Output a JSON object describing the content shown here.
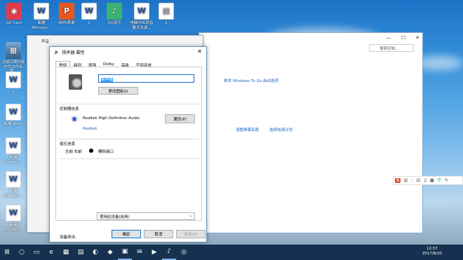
{
  "desktop": {
    "icons": [
      {
        "label": "Gif Cam",
        "icon": "camera-icon",
        "kind": "cam"
      },
      {
        "label": "新建 Microso...",
        "icon": "word-document-icon",
        "kind": "word"
      },
      {
        "label": "WPS表单",
        "icon": "wps-icon",
        "kind": "wps"
      },
      {
        "label": "1",
        "icon": "word-document-icon",
        "kind": "word"
      },
      {
        "label": "QQ音乐",
        "icon": "music-icon",
        "kind": "qq"
      },
      {
        "label": "电脑中出现音量无法调...",
        "icon": "word-document-icon",
        "kind": "word"
      },
      {
        "label": "1",
        "icon": "file-icon",
        "kind": "pdf"
      }
    ],
    "left_icons": [
      {
        "label": "当前日期内容作为文件名称...",
        "icon": "image-file-icon",
        "kind": "imgfile"
      },
      {
        "label": "2",
        "icon": "word-document-icon",
        "kind": "word"
      },
      {
        "label": "新建 Word",
        "icon": "word-document-icon",
        "kind": "word"
      },
      {
        "label": "新建 Microso...",
        "icon": "word-document-icon",
        "kind": "word"
      },
      {
        "label": "新建 Microso...",
        "icon": "word-document-icon",
        "kind": "word"
      },
      {
        "label": "新建 Microso...",
        "icon": "word-document-icon",
        "kind": "word"
      }
    ]
  },
  "explorer": {
    "search_placeholder": "搜索控制...",
    "links": [
      "更改 Windows To Go 启动选项",
      "调整屏幕亮度",
      "选择电源计划"
    ]
  },
  "sound_window": {
    "title": "声音"
  },
  "dialog": {
    "title": "扬声器 属性",
    "close": "✕",
    "tabs": [
      "常规",
      "级别",
      "增强",
      "Dolby",
      "高级",
      "空间音效"
    ],
    "device_name": "扬声器",
    "change_icon_button": "更改图标(I)",
    "controller_info_label": "控制器信息",
    "controller_name": "Realtek High Definition Audio",
    "controller_vendor": "Realtek",
    "properties_button": "属性(P)",
    "jack_info_label": "插孔信息",
    "jack_positions": "左前 右前",
    "jack_type": "模拟接口",
    "device_usage_label": "设备用法:",
    "device_usage_value": "使用此设备(启用)",
    "ok_button": "确定",
    "cancel_button": "取消",
    "apply_button": "应用(A)"
  },
  "ime": {
    "logo": "S"
  },
  "taskbar": {
    "time": "12:57",
    "date": "2017/8/20"
  }
}
